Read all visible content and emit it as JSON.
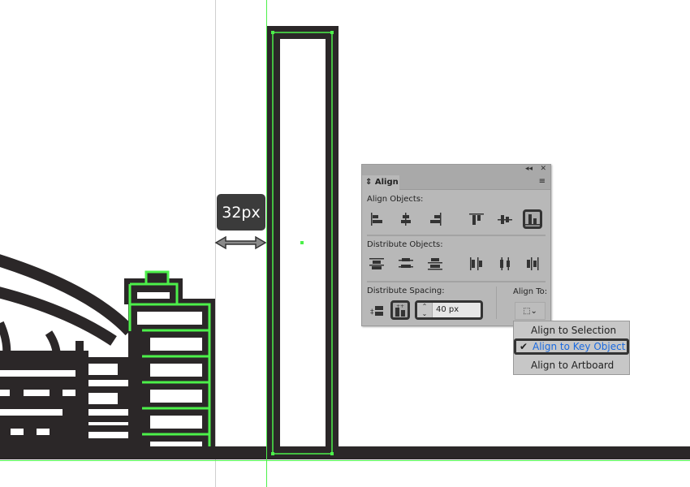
{
  "canvas": {
    "measure_label": "32px",
    "colors": {
      "artwork": "#2b2728",
      "selection": "#4cf04a",
      "guide": "#cccccc"
    }
  },
  "align_panel": {
    "title": "Align",
    "align_objects_label": "Align Objects:",
    "align_objects_buttons": [
      "horizontal-align-left-icon",
      "horizontal-align-center-icon",
      "horizontal-align-right-icon",
      "vertical-align-top-icon",
      "vertical-align-center-icon",
      "vertical-align-bottom-icon"
    ],
    "align_objects_selected": "vertical-align-bottom-icon",
    "distribute_objects_label": "Distribute Objects:",
    "distribute_objects_buttons": [
      "vertical-distribute-top-icon",
      "vertical-distribute-center-icon",
      "vertical-distribute-bottom-icon",
      "horizontal-distribute-left-icon",
      "horizontal-distribute-center-icon",
      "horizontal-distribute-right-icon"
    ],
    "distribute_spacing_label": "Distribute Spacing:",
    "spacing_value": "40 px",
    "align_to_label": "Align To:"
  },
  "align_to_menu": {
    "items": [
      "Align to Selection",
      "Align to Key Object",
      "Align to Artboard"
    ],
    "selected": "Align to Key Object",
    "selected_color": "#1a6ae0"
  }
}
